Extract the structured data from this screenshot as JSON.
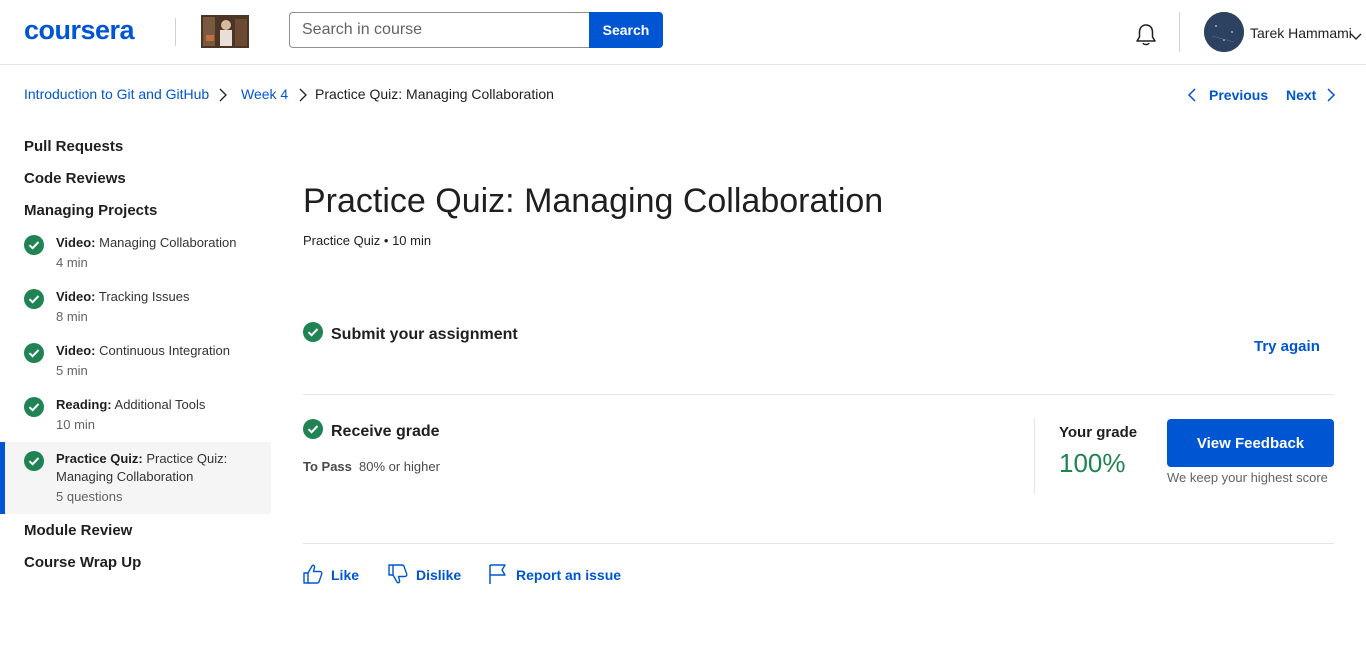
{
  "header": {
    "logo": "coursera",
    "search_placeholder": "Search in course",
    "search_button": "Search",
    "user_name": "Tarek Hammami"
  },
  "breadcrumb": {
    "course": "Introduction to Git and GitHub",
    "week": "Week 4",
    "current": "Practice Quiz: Managing Collaboration"
  },
  "nav": {
    "previous": "Previous",
    "next": "Next"
  },
  "sidebar": {
    "sections": [
      "Pull Requests",
      "Code Reviews",
      "Managing Projects",
      "Module Review",
      "Course Wrap Up"
    ],
    "items": [
      {
        "type": "Video:",
        "title": "Managing Collaboration",
        "meta": "4 min"
      },
      {
        "type": "Video:",
        "title": "Tracking Issues",
        "meta": "8 min"
      },
      {
        "type": "Video:",
        "title": "Continuous Integration",
        "meta": "5 min"
      },
      {
        "type": "Reading:",
        "title": "Additional Tools",
        "meta": "10 min"
      },
      {
        "type": "Practice Quiz:",
        "title": "Practice Quiz: Managing Collaboration",
        "meta": "5 questions"
      }
    ]
  },
  "main": {
    "title": "Practice Quiz: Managing Collaboration",
    "meta": "Practice Quiz • 10 min",
    "submit_label": "Submit your assignment",
    "try_again": "Try again",
    "receive_label": "Receive grade",
    "to_pass_label": "To Pass",
    "to_pass_value": "80% or higher",
    "grade_label": "Your grade",
    "grade_value": "100%",
    "feedback_button": "View Feedback",
    "keep_note": "We keep your highest score",
    "like": "Like",
    "dislike": "Dislike",
    "report": "Report an issue"
  },
  "colors": {
    "brand": "#0056d2",
    "success": "#1f8354"
  }
}
